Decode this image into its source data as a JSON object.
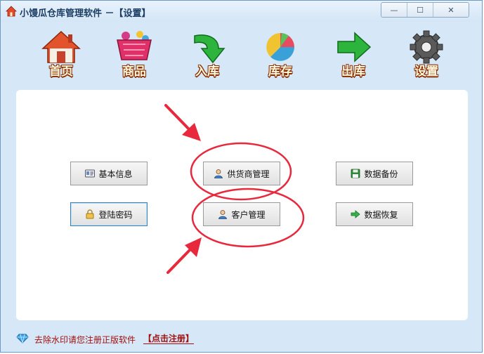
{
  "window": {
    "title": "小馒瓜仓库管理软件 －【设置】",
    "controls": {
      "minimize": "—",
      "maximize": "☐",
      "close": "✕"
    }
  },
  "toolbar": {
    "items": [
      {
        "label": "首页",
        "icon": "home-icon"
      },
      {
        "label": "商品",
        "icon": "shopping-basket-icon"
      },
      {
        "label": "入库",
        "icon": "green-arrow-in-icon"
      },
      {
        "label": "库存",
        "icon": "pie-chart-icon"
      },
      {
        "label": "出库",
        "icon": "green-arrow-out-icon"
      },
      {
        "label": "设置",
        "icon": "gear-icon"
      }
    ]
  },
  "settings": {
    "buttons": {
      "basic_info": "基本信息",
      "login_password": "登陆密码",
      "supplier_mgmt": "供货商管理",
      "customer_mgmt": "客户管理",
      "data_backup": "数据备份",
      "data_restore": "数据恢复"
    }
  },
  "status": {
    "message": "去除水印请您注册正版软件",
    "link": "【点击注册】"
  },
  "colors": {
    "window_bg": "#d6e8f7",
    "annotation_red": "#e8283c",
    "status_text": "#a01010"
  }
}
